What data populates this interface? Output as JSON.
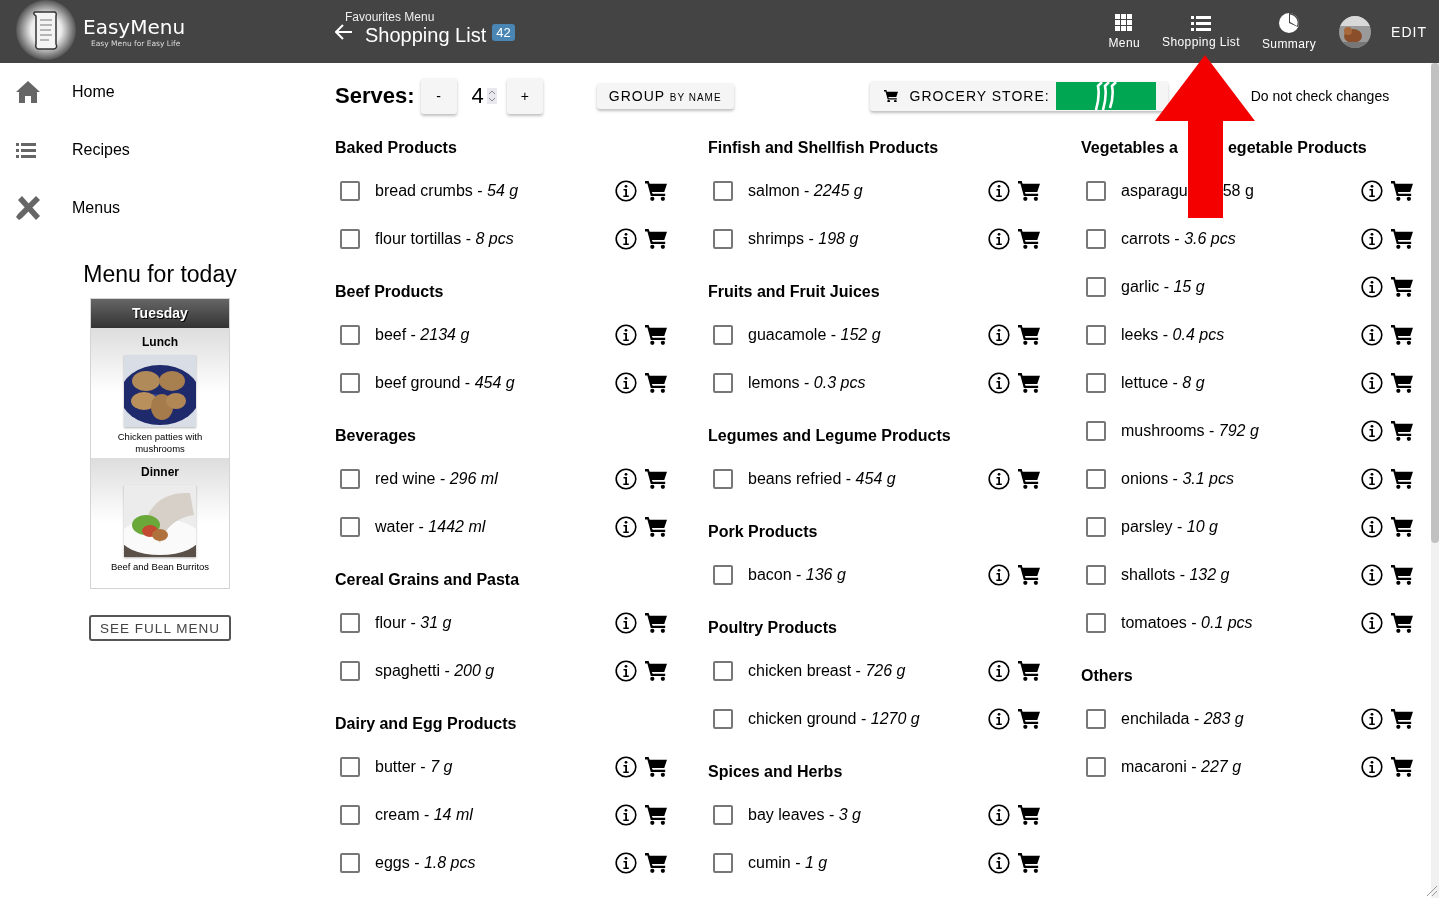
{
  "app": {
    "name": "EasyMenu",
    "tagline": "Easy Menu for Easy Life"
  },
  "header": {
    "subtitle": "Favourites Menu",
    "title": "Shopping List",
    "count": "42",
    "nav": [
      {
        "label": "Menu"
      },
      {
        "label": "Shopping List"
      },
      {
        "label": "Summary"
      }
    ],
    "edit": "EDIT"
  },
  "sidebar": {
    "items": [
      {
        "label": "Home"
      },
      {
        "label": "Recipes"
      },
      {
        "label": "Menus"
      }
    ],
    "today": {
      "title": "Menu for today",
      "day": "Tuesday",
      "meals": [
        {
          "name": "Lunch",
          "dish": "Chicken patties with mushrooms",
          "kind": "patties"
        },
        {
          "name": "Dinner",
          "dish": "Beef and Bean Burritos",
          "kind": "burrito"
        }
      ],
      "button": "SEE FULL MENU"
    }
  },
  "toolbar": {
    "serves_label": "Serves:",
    "minus": "-",
    "serves": "4",
    "plus": "+",
    "group": {
      "main": "GROUP",
      "sub": "BY NAME"
    },
    "store_label": "GROCERY STORE:",
    "note": "Do not check changes"
  },
  "columns": [
    [
      {
        "title": "Baked Products",
        "items": [
          {
            "name": "bread crumbs -",
            "amount": "54 g",
            "checked": false
          },
          {
            "name": "flour tortillas -",
            "amount": "8 pcs",
            "checked": false
          }
        ]
      },
      {
        "title": "Beef Products",
        "items": [
          {
            "name": "beef -",
            "amount": "2134 g",
            "checked": false
          },
          {
            "name": "beef ground -",
            "amount": "454 g",
            "checked": false
          }
        ]
      },
      {
        "title": "Beverages",
        "items": [
          {
            "name": "red wine -",
            "amount": "296 ml",
            "checked": false
          },
          {
            "name": "water -",
            "amount": "1442 ml",
            "checked": false
          }
        ]
      },
      {
        "title": "Cereal Grains and Pasta",
        "items": [
          {
            "name": "flour -",
            "amount": "31 g",
            "checked": false
          },
          {
            "name": "spaghetti -",
            "amount": "200 g",
            "checked": false
          }
        ]
      },
      {
        "title": "Dairy and Egg Products",
        "items": [
          {
            "name": "butter -",
            "amount": "7 g",
            "checked": false
          },
          {
            "name": "cream -",
            "amount": "14 ml",
            "checked": false
          },
          {
            "name": "eggs -",
            "amount": "1.8 pcs",
            "checked": false
          }
        ]
      }
    ],
    [
      {
        "title": "Finfish and Shellfish Products",
        "items": [
          {
            "name": "salmon -",
            "amount": "2245 g",
            "checked": false
          },
          {
            "name": "shrimps -",
            "amount": "198 g",
            "checked": false
          }
        ]
      },
      {
        "title": "Fruits and Fruit Juices",
        "items": [
          {
            "name": "guacamole -",
            "amount": "152 g",
            "checked": false
          },
          {
            "name": "lemons -",
            "amount": "0.3 pcs",
            "checked": false
          }
        ]
      },
      {
        "title": "Legumes and Legume Products",
        "items": [
          {
            "name": "beans refried -",
            "amount": "454 g",
            "checked": false
          }
        ]
      },
      {
        "title": "Pork Products",
        "items": [
          {
            "name": "bacon -",
            "amount": "136 g",
            "checked": false
          }
        ]
      },
      {
        "title": "Poultry Products",
        "items": [
          {
            "name": "chicken breast -",
            "amount": "726 g",
            "checked": false
          },
          {
            "name": "chicken ground -",
            "amount": "1270 g",
            "checked": false
          }
        ]
      },
      {
        "title": "Spices and Herbs",
        "items": [
          {
            "name": "bay leaves -",
            "amount": "3 g",
            "checked": false
          },
          {
            "name": "cumin -",
            "amount": "1 g",
            "checked": false
          }
        ]
      }
    ],
    [
      {
        "title": "Vegetables a",
        "title_after": "egetable Products",
        "items": [
          {
            "name": "asparagu",
            "amount": "58 g",
            "checked": false,
            "kind": "covered"
          },
          {
            "name": "carrots -",
            "amount": "3.6 pcs",
            "checked": false
          },
          {
            "name": "garlic -",
            "amount": "15 g",
            "checked": false
          },
          {
            "name": "leeks -",
            "amount": "0.4 pcs",
            "checked": false
          },
          {
            "name": "lettuce -",
            "amount": "8 g",
            "checked": false
          },
          {
            "name": "mushrooms -",
            "amount": "792 g",
            "checked": false
          },
          {
            "name": "onions -",
            "amount": "3.1 pcs",
            "checked": false
          },
          {
            "name": "parsley -",
            "amount": "10 g",
            "checked": false
          },
          {
            "name": "shallots -",
            "amount": "132 g",
            "checked": false
          },
          {
            "name": "tomatoes -",
            "amount": "0.1 pcs",
            "checked": false
          }
        ]
      },
      {
        "title": "Others",
        "items": [
          {
            "name": "enchilada -",
            "amount": "283 g",
            "checked": false
          },
          {
            "name": "macaroni -",
            "amount": "227 g",
            "checked": false
          }
        ]
      }
    ]
  ]
}
